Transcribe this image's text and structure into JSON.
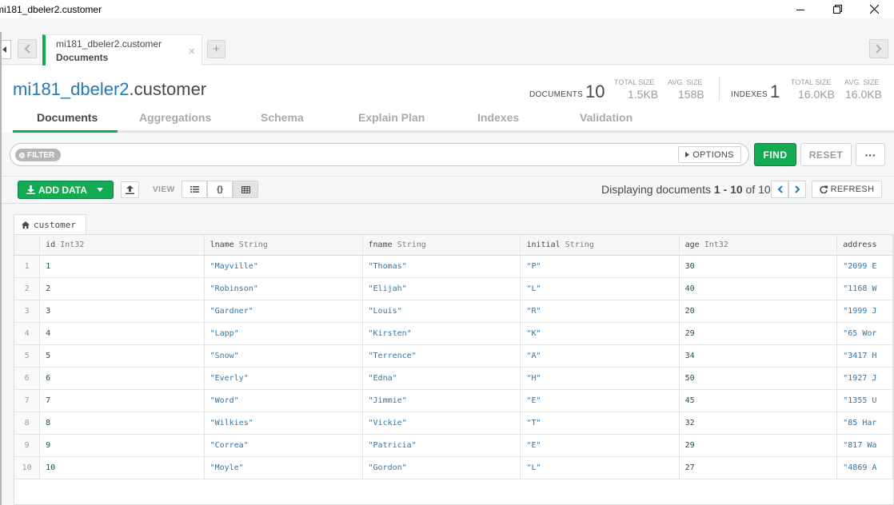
{
  "window": {
    "title": "mi181_dbeler2.customer"
  },
  "tab": {
    "namespace": "mi181_dbeler2.customer",
    "subtitle": "Documents",
    "close_glyph": "×",
    "add_glyph": "+"
  },
  "header": {
    "db": "mi181_dbeler2",
    "collection": ".customer",
    "documents_label": "DOCUMENTS",
    "documents_count": "10",
    "doc_total_size_label": "TOTAL SIZE",
    "doc_total_size": "1.5KB",
    "doc_avg_size_label": "AVG. SIZE",
    "doc_avg_size": "158B",
    "indexes_label": "INDEXES",
    "indexes_count": "1",
    "idx_total_size_label": "TOTAL SIZE",
    "idx_total_size": "16.0KB",
    "idx_avg_size_label": "AVG. SIZE",
    "idx_avg_size": "16.0KB"
  },
  "subtabs": [
    "Documents",
    "Aggregations",
    "Schema",
    "Explain Plan",
    "Indexes",
    "Validation"
  ],
  "filter": {
    "pill_label": "FILTER",
    "options_label": "OPTIONS",
    "find_label": "FIND",
    "reset_label": "RESET",
    "more_label": "···"
  },
  "actions": {
    "add_data_label": "ADD DATA",
    "view_label": "VIEW",
    "list_view_glyph": "☰",
    "json_view_glyph": "{}",
    "paging_prefix": "Displaying documents ",
    "paging_range": "1 - 10",
    "paging_suffix": " of 10",
    "refresh_label": "REFRESH"
  },
  "table": {
    "collection_tab": "customer",
    "columns": [
      {
        "name": "id",
        "type": "Int32"
      },
      {
        "name": "lname",
        "type": "String"
      },
      {
        "name": "fname",
        "type": "String"
      },
      {
        "name": "initial",
        "type": "String"
      },
      {
        "name": "age",
        "type": "Int32"
      },
      {
        "name": "address",
        "type": ""
      }
    ],
    "rows": [
      {
        "n": "1",
        "id": "1",
        "lname": "\"Mayville\"",
        "fname": "\"Thomas\"",
        "initial": "\"P\"",
        "age": "30",
        "address": "\"2099 E"
      },
      {
        "n": "2",
        "id": "2",
        "lname": "\"Robinson\"",
        "fname": "\"Elijah\"",
        "initial": "\"L\"",
        "age": "40",
        "address": "\"1168 W"
      },
      {
        "n": "3",
        "id": "3",
        "lname": "\"Gardner\"",
        "fname": "\"Louis\"",
        "initial": "\"R\"",
        "age": "20",
        "address": "\"1999 J"
      },
      {
        "n": "4",
        "id": "4",
        "lname": "\"Lapp\"",
        "fname": "\"Kirsten\"",
        "initial": "\"K\"",
        "age": "29",
        "address": "\"65 Wor"
      },
      {
        "n": "5",
        "id": "5",
        "lname": "\"Snow\"",
        "fname": "\"Terrence\"",
        "initial": "\"A\"",
        "age": "34",
        "address": "\"3417 H"
      },
      {
        "n": "6",
        "id": "6",
        "lname": "\"Everly\"",
        "fname": "\"Edna\"",
        "initial": "\"H\"",
        "age": "50",
        "address": "\"1927 J"
      },
      {
        "n": "7",
        "id": "7",
        "lname": "\"Word\"",
        "fname": "\"Jimmie\"",
        "initial": "\"E\"",
        "age": "45",
        "address": "\"1355 U"
      },
      {
        "n": "8",
        "id": "8",
        "lname": "\"Wilkies\"",
        "fname": "\"Vickie\"",
        "initial": "\"T\"",
        "age": "32",
        "address": "\"85 Har"
      },
      {
        "n": "9",
        "id": "9",
        "lname": "\"Correa\"",
        "fname": "\"Patricia\"",
        "initial": "\"E\"",
        "age": "29",
        "address": "\"817 Wa"
      },
      {
        "n": "10",
        "id": "10",
        "lname": "\"Moyle\"",
        "fname": "\"Gordon\"",
        "initial": "\"L\"",
        "age": "27",
        "address": "\"4869 A"
      }
    ]
  },
  "colors": {
    "accent_green": "#13aa52",
    "link_blue": "#2579b3"
  }
}
